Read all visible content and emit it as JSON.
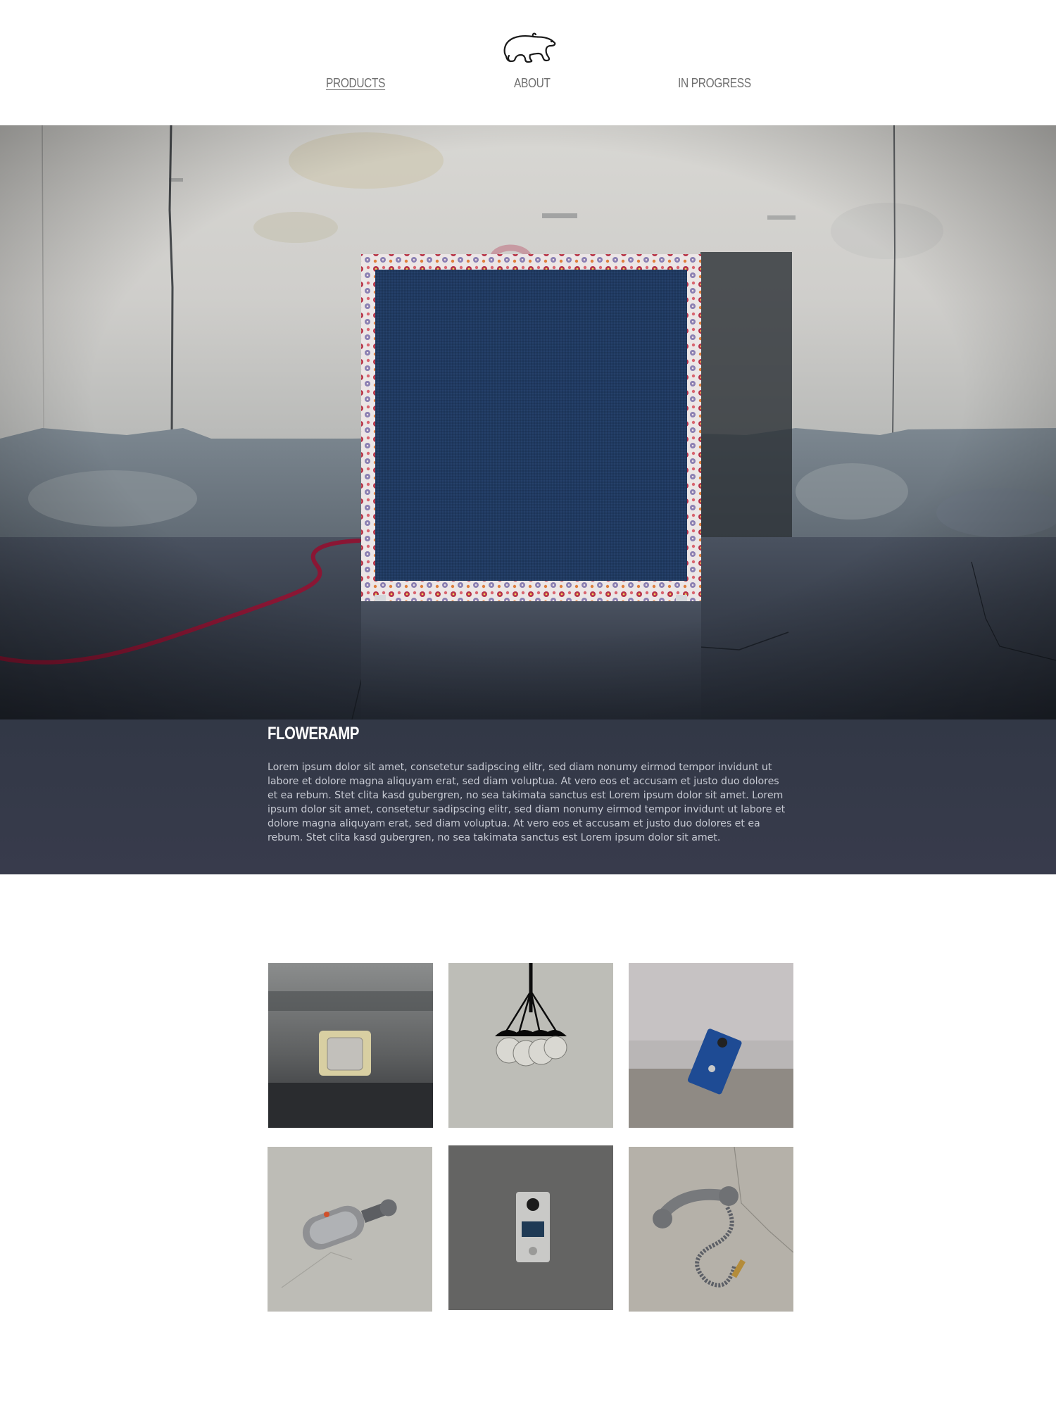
{
  "nav": {
    "items": [
      {
        "label": "PRODUCTS",
        "active": true
      },
      {
        "label": "ABOUT",
        "active": false
      },
      {
        "label": "IN PROGRESS",
        "active": false
      }
    ]
  },
  "logo": {
    "icon": "polar-bear-icon"
  },
  "hero": {
    "image": "amplifier-with-floral-trim-photo"
  },
  "product": {
    "title": "FLOWERAMP",
    "description": "Lorem ipsum dolor sit amet, consetetur sadipscing elitr, sed diam nonumy eirmod tempor invidunt ut labore et dolore magna aliquyam erat, sed diam voluptua. At vero eos et accusam et justo duo dolores et ea rebum. Stet clita kasd gubergren, no sea takimata sanctus est Lorem ipsum dolor sit amet. Lorem ipsum dolor sit amet, consetetur sadipscing elitr, sed diam nonumy eirmod tempor invidunt ut labore et dolore magna aliquyam erat, sed diam voluptua. At vero eos et accusam et justo duo dolores et ea rebum. Stet clita kasd gubergren, no sea takimata sanctus est Lorem ipsum dolor sit amet."
  },
  "gallery": [
    {
      "subject": "cream-amp-photo"
    },
    {
      "subject": "bulb-cluster-lamp-photo"
    },
    {
      "subject": "blue-pedal-photo"
    },
    {
      "subject": "vintage-microphone-photo"
    },
    {
      "subject": "silver-pedal-photo"
    },
    {
      "subject": "telephone-handset-photo"
    }
  ],
  "colors": {
    "caption_bg": "#343a48",
    "caption_text": "#c6c9d2",
    "nav_text": "#6f6f6f",
    "amp_grille": "#213a62"
  }
}
